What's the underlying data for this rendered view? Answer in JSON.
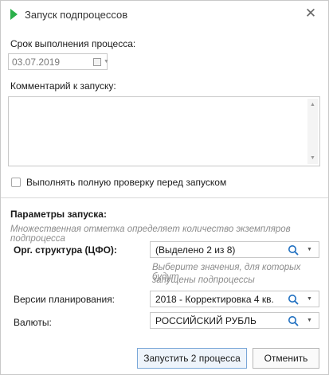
{
  "window": {
    "title": "Запуск подпроцессов",
    "close_symbol": "✕"
  },
  "deadline": {
    "label": "Срок выполнения процесса:",
    "value": "03.07.2019"
  },
  "comment": {
    "label": "Комментарий к запуску:",
    "value": ""
  },
  "full_check": {
    "label": "Выполнять полную проверку перед запуском",
    "checked": false
  },
  "params": {
    "title": "Параметры запуска:",
    "hint": "Множественная отметка определяет количество экземпляров подпроцесса",
    "org": {
      "label": "Орг. структура (ЦФО):",
      "value": "(Выделено 2 из 8)",
      "hint_line1": "Выберите значения, для которых будут",
      "hint_line2": "запущены подпроцессы"
    },
    "versions": {
      "label": "Версии планирования:",
      "value": "2018 - Корректировка 4 кв."
    },
    "currency": {
      "label": "Валюты:",
      "value": "РОССИЙСКИЙ РУБЛЬ"
    }
  },
  "buttons": {
    "run": "Запустить 2 процесса",
    "cancel": "Отменить"
  },
  "icons": {
    "play": "play-icon",
    "search": "search-icon",
    "dropdown": "chevron-down-icon",
    "calendar": "calendar-icon"
  },
  "colors": {
    "accent_green": "#2bb04a",
    "primary_border": "#7aa7d8",
    "hint_text": "#8c8c8c"
  }
}
